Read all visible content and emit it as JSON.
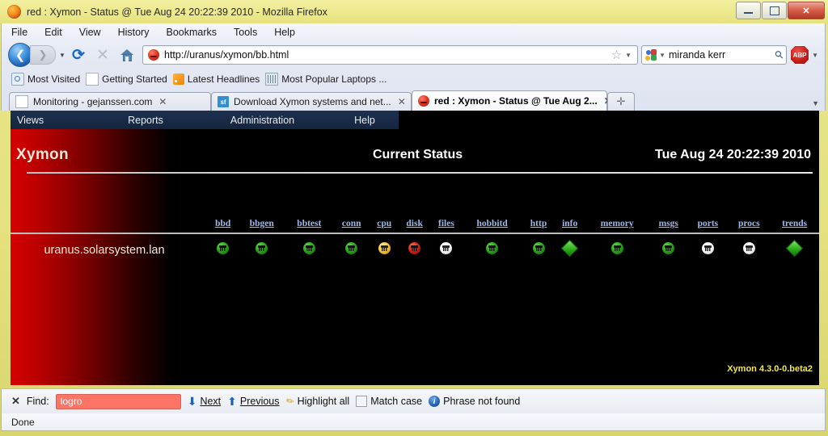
{
  "window": {
    "title": "red : Xymon - Status @ Tue Aug 24 20:22:39 2010 - Mozilla Firefox",
    "minimize_label": "Minimize",
    "maximize_label": "Maximize",
    "close_label": "✕"
  },
  "menubar": [
    "File",
    "Edit",
    "View",
    "History",
    "Bookmarks",
    "Tools",
    "Help"
  ],
  "toolbar": {
    "back_glyph": "❮",
    "forward_glyph": "❯",
    "history_dropdown_glyph": "▼",
    "reload_glyph": "⟳",
    "stop_glyph": "✕",
    "url": "http://uranus/xymon/bb.html",
    "star_glyph": "☆",
    "url_dropdown_glyph": "▼",
    "search_value": "miranda kerr",
    "search_dropdown_glyph": "▼",
    "magnifier_glyph": "⚲",
    "adblock_label": "ABP",
    "adblock_dropdown_glyph": "▼"
  },
  "bookmarks": [
    "Most Visited",
    "Getting Started",
    "Latest Headlines",
    "Most Popular Laptops ..."
  ],
  "tabs": [
    {
      "label": "Monitoring - gejanssen.com",
      "close_glyph": "✕",
      "active": false
    },
    {
      "label": "Download Xymon systems and net...",
      "favicon_text": "sf",
      "close_glyph": "✕",
      "active": false
    },
    {
      "label": "red : Xymon - Status @ Tue Aug 2...",
      "close_glyph": "✕",
      "active": true
    }
  ],
  "newtab_glyph": "✛",
  "taball_glyph": "▼",
  "xymon": {
    "nav": [
      "Views",
      "Reports",
      "Administration",
      "Help"
    ],
    "brand": "Xymon",
    "page_title": "Current Status",
    "timestamp": "Tue Aug 24 20:22:39 2010",
    "columns": [
      "bbd",
      "bbgen",
      "bbtest",
      "conn",
      "cpu",
      "disk",
      "files",
      "hobbitd",
      "http",
      "info",
      "memory",
      "msgs",
      "ports",
      "procs",
      "trends"
    ],
    "rows": [
      {
        "host": "uranus.solarsystem.lan",
        "statuses": [
          "green",
          "green",
          "green",
          "green",
          "yellow",
          "red",
          "clear",
          "green",
          "green",
          "diamond",
          "green",
          "green",
          "clear",
          "clear",
          "diamond"
        ]
      }
    ],
    "footer": "Xymon 4.3.0-0.beta2"
  },
  "findbar": {
    "close_glyph": "✕",
    "label": "Find:",
    "value": "logro",
    "next_label": "Next",
    "next_glyph": "⬇",
    "previous_label": "Previous",
    "previous_glyph": "⬆",
    "highlight_label": "Highlight all",
    "highlight_glyph": "✎",
    "matchcase_label": "Match case",
    "result_text": "Phrase not found",
    "result_glyph": "i"
  },
  "statusbar": {
    "text": "Done"
  }
}
